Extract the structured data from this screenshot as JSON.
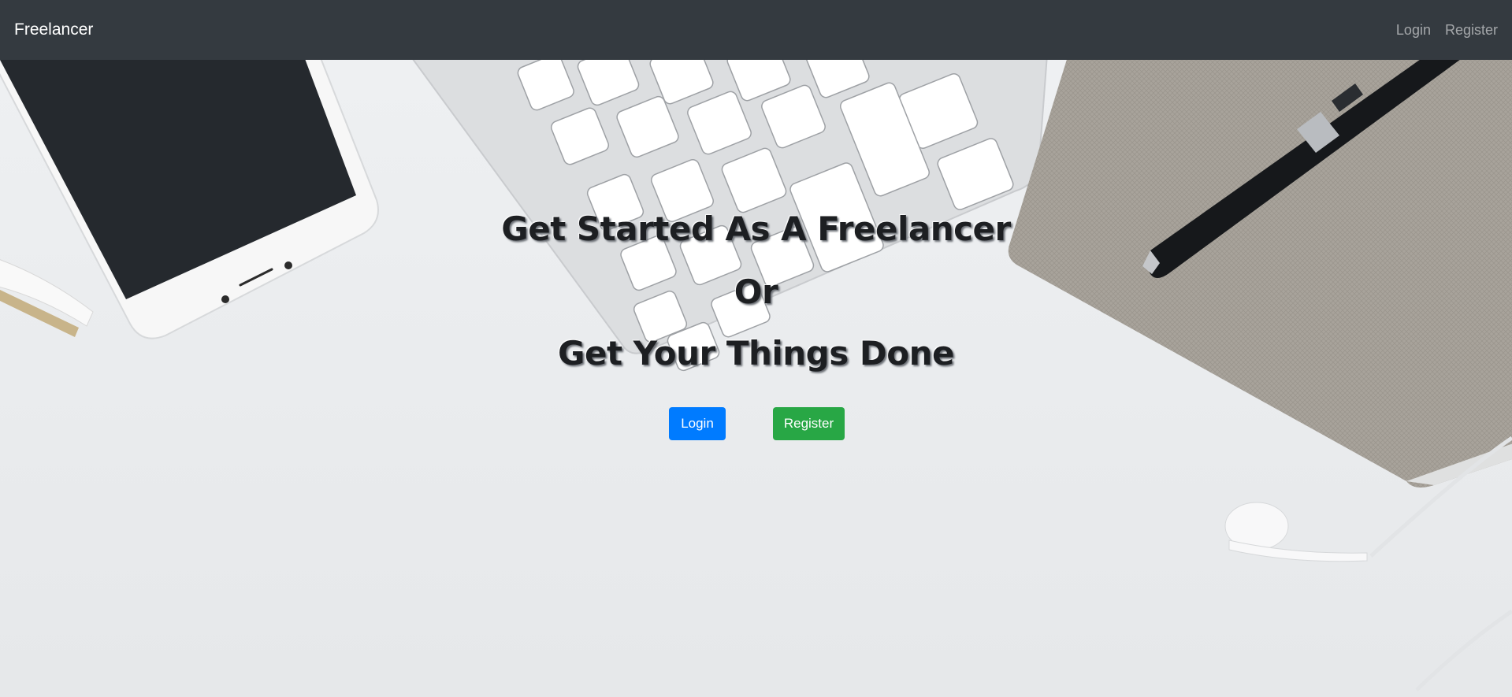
{
  "navbar": {
    "brand": "Freelancer",
    "links": [
      "Login",
      "Register"
    ]
  },
  "hero": {
    "line1": "Get Started As A Freelancer",
    "line2": "Or",
    "line3": "Get Your Things Done"
  },
  "buttons": {
    "login": "Login",
    "register": "Register"
  },
  "colors": {
    "navbar": "#343a40",
    "login_button": "#007bff",
    "register_button": "#28a745"
  },
  "background_image": [
    "smartphone",
    "keyboard",
    "notebook",
    "pen",
    "earphones"
  ]
}
